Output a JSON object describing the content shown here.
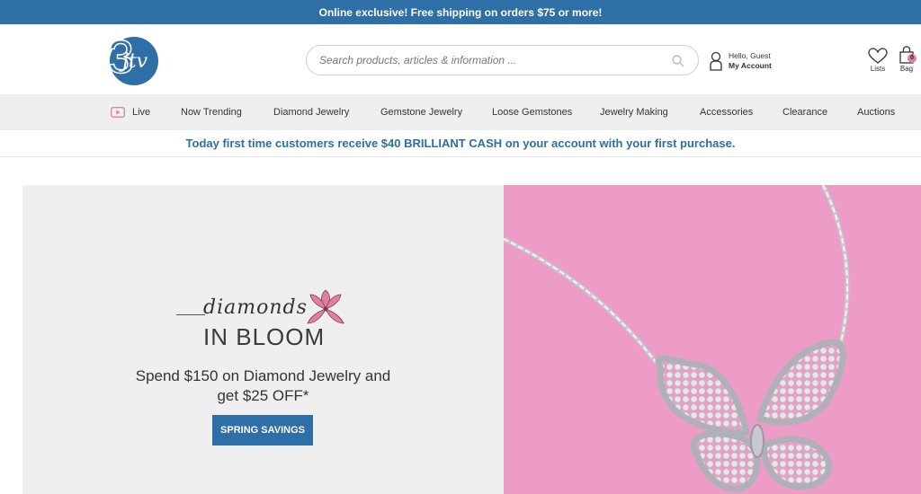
{
  "banner": {
    "text": "Online exclusive! Free shipping on orders $75 or more!"
  },
  "logo": {
    "text": "jtv",
    "number": "3"
  },
  "search": {
    "placeholder": "Search products, articles & information ..."
  },
  "account": {
    "greeting": "Hello, Guest",
    "link": "My Account"
  },
  "header_icons": {
    "lists_label": "Lists",
    "bag_label": "Bag",
    "bag_count": "0"
  },
  "nav": {
    "items": [
      {
        "label": "Live",
        "icon": "play-icon"
      },
      {
        "label": "Now Trending"
      },
      {
        "label": "Diamond Jewelry"
      },
      {
        "label": "Gemstone Jewelry"
      },
      {
        "label": "Loose Gemstones"
      },
      {
        "label": "Jewelry Making"
      },
      {
        "label": "Accessories"
      },
      {
        "label": "Clearance"
      },
      {
        "label": "Auctions"
      }
    ]
  },
  "promo": {
    "text": "Today first time customers receive $40 BRILLIANT CASH on your account with your first purchase."
  },
  "hero": {
    "brand_script": "diamonds",
    "brand_main": "IN BLOOM",
    "offer_line1": "Spend $150 on Diamond Jewelry and",
    "offer_line2": "get $25 OFF*",
    "cta": "SPRING SAVINGS"
  },
  "colors": {
    "brand_blue": "#2f6fa7",
    "hero_pink": "#ec9cc6",
    "flower_pink": "#e27fa1",
    "nav_bg": "#efefef"
  }
}
